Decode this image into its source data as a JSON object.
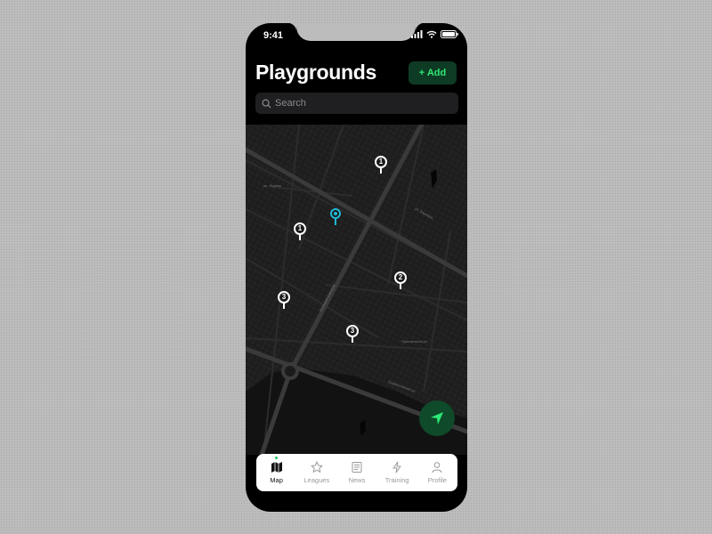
{
  "status": {
    "time": "9:41"
  },
  "header": {
    "title": "Playgrounds",
    "add_label": "+ Add"
  },
  "search": {
    "placeholder": "Search"
  },
  "map": {
    "pins": [
      {
        "label": "1"
      },
      {
        "label": "1"
      },
      {
        "label": "2"
      },
      {
        "label": "3"
      },
      {
        "label": "3"
      }
    ]
  },
  "tabs": [
    {
      "label": "Map",
      "icon": "map-icon",
      "active": true
    },
    {
      "label": "Leagues",
      "icon": "star-icon",
      "active": false
    },
    {
      "label": "News",
      "icon": "news-icon",
      "active": false
    },
    {
      "label": "Training",
      "icon": "lightning-icon",
      "active": false
    },
    {
      "label": "Profile",
      "icon": "user-icon",
      "active": false
    }
  ],
  "colors": {
    "accent": "#22c55e",
    "add_text": "#2ee876",
    "add_bg": "#0e3b23",
    "user_location": "#1fb8d6",
    "background": "#000000"
  }
}
